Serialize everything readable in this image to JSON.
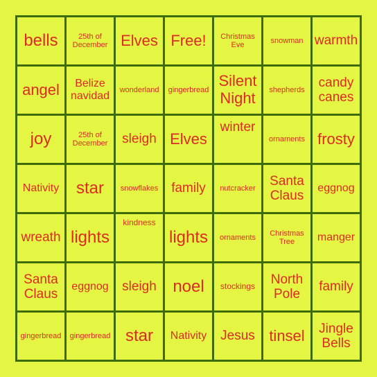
{
  "colors": {
    "background": "#e4f544",
    "grid_line": "#3e6b09",
    "text": "#dc2b24"
  },
  "board": {
    "rows": 7,
    "cols": 7,
    "cells": [
      [
        "bells",
        "25th of December",
        "Elves",
        "Free!",
        "Christmas Eve",
        "snowman",
        "warmth"
      ],
      [
        "angel",
        "Belize navidad",
        "wonderland",
        "gingerbread",
        "Silent Night",
        "shepherds",
        "candy canes"
      ],
      [
        "joy",
        "25th of December",
        "sleigh",
        "Elves",
        "winter",
        "ornaments",
        "frosty"
      ],
      [
        "Nativity",
        "star",
        "snowflakes",
        "family",
        "nutcracker",
        "Santa Claus",
        "eggnog"
      ],
      [
        "wreath",
        "lights",
        "kindness",
        "lights",
        "ornaments",
        "Christmas Tree",
        "manger"
      ],
      [
        "Santa Claus",
        "eggnog",
        "sleigh",
        "noel",
        "stockings",
        "North Pole",
        "family"
      ],
      [
        "gingerbread",
        "gingerbread",
        "star",
        "Nativity",
        "Jesus",
        "tinsel",
        "Jingle Bells"
      ]
    ]
  }
}
